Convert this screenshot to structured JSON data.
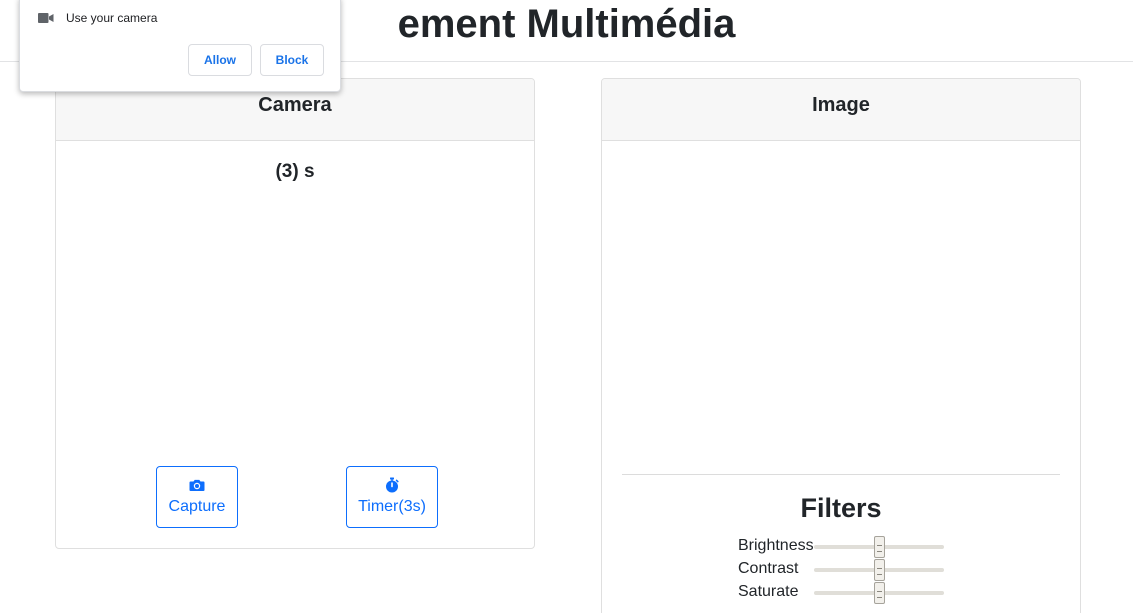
{
  "page": {
    "title": "ement Multimédia"
  },
  "permission_prompt": {
    "icon": "video-camera-icon",
    "message": "Use your camera",
    "allow_label": "Allow",
    "block_label": "Block"
  },
  "camera_card": {
    "header": "Camera",
    "countdown": "(3) s",
    "capture": {
      "icon": "camera-icon",
      "label": "Capture"
    },
    "timer": {
      "icon": "stopwatch-icon",
      "label": "Timer(3s)"
    }
  },
  "image_card": {
    "header": "Image",
    "filters_title": "Filters",
    "filters": [
      {
        "label": "Brightness",
        "level": 0.5
      },
      {
        "label": "Contrast",
        "level": 0.5
      },
      {
        "label": "Saturate",
        "level": 0.5
      }
    ]
  },
  "colors": {
    "accent": "#0d6efd",
    "card_header_bg": "#f7f7f7",
    "popup_button_text": "#1a73e8"
  }
}
